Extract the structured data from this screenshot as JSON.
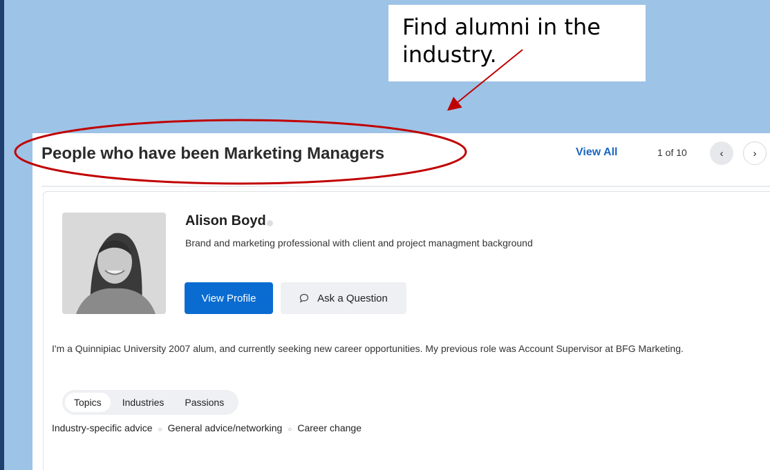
{
  "callout": {
    "text": "Find alumni in the industry."
  },
  "section": {
    "title": "People who have been Marketing Managers",
    "view_all": "View All",
    "page_count": "1 of 10",
    "prev_glyph": "‹",
    "next_glyph": "›"
  },
  "profile": {
    "name": "Alison Boyd",
    "headline": "Brand and marketing professional with client and project managment background",
    "view_profile_label": "View Profile",
    "ask_label": "Ask a Question",
    "bio": "I'm a Quinnipiac University 2007 alum, and currently seeking new career opportunities. My previous role was Account Supervisor at BFG Marketing."
  },
  "tabs": [
    {
      "label": "Topics",
      "active": true
    },
    {
      "label": "Industries",
      "active": false
    },
    {
      "label": "Passions",
      "active": false
    }
  ],
  "topics": [
    "Industry-specific advice",
    "General advice/networking",
    "Career change"
  ],
  "icons": {
    "prev": "chevron-left-icon",
    "next": "chevron-right-icon",
    "ask": "chat-bubble-icon",
    "status": "status-dot-icon"
  },
  "colors": {
    "slide_background": "#9dc3e6",
    "annotation_red": "#c00000",
    "primary_button": "#0a6cd1",
    "link_blue": "#1a66c2"
  }
}
